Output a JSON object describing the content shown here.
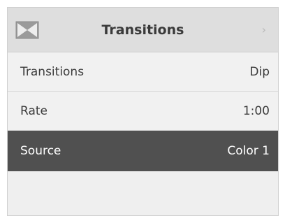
{
  "header": {
    "icon": "transition-icon",
    "title": "Transitions",
    "chevron": "›"
  },
  "menu": {
    "items": [
      {
        "label": "Transitions",
        "value": "Dip"
      },
      {
        "label": "Rate",
        "value": "1:00"
      },
      {
        "label": "Source",
        "value": "Color 1",
        "selected": true
      }
    ]
  },
  "colors": {
    "header_bg": "#dedede",
    "row_bg": "#f1f1f1",
    "selected_bg": "#505050",
    "text": "#3c3c3c",
    "selected_text": "#ffffff"
  }
}
